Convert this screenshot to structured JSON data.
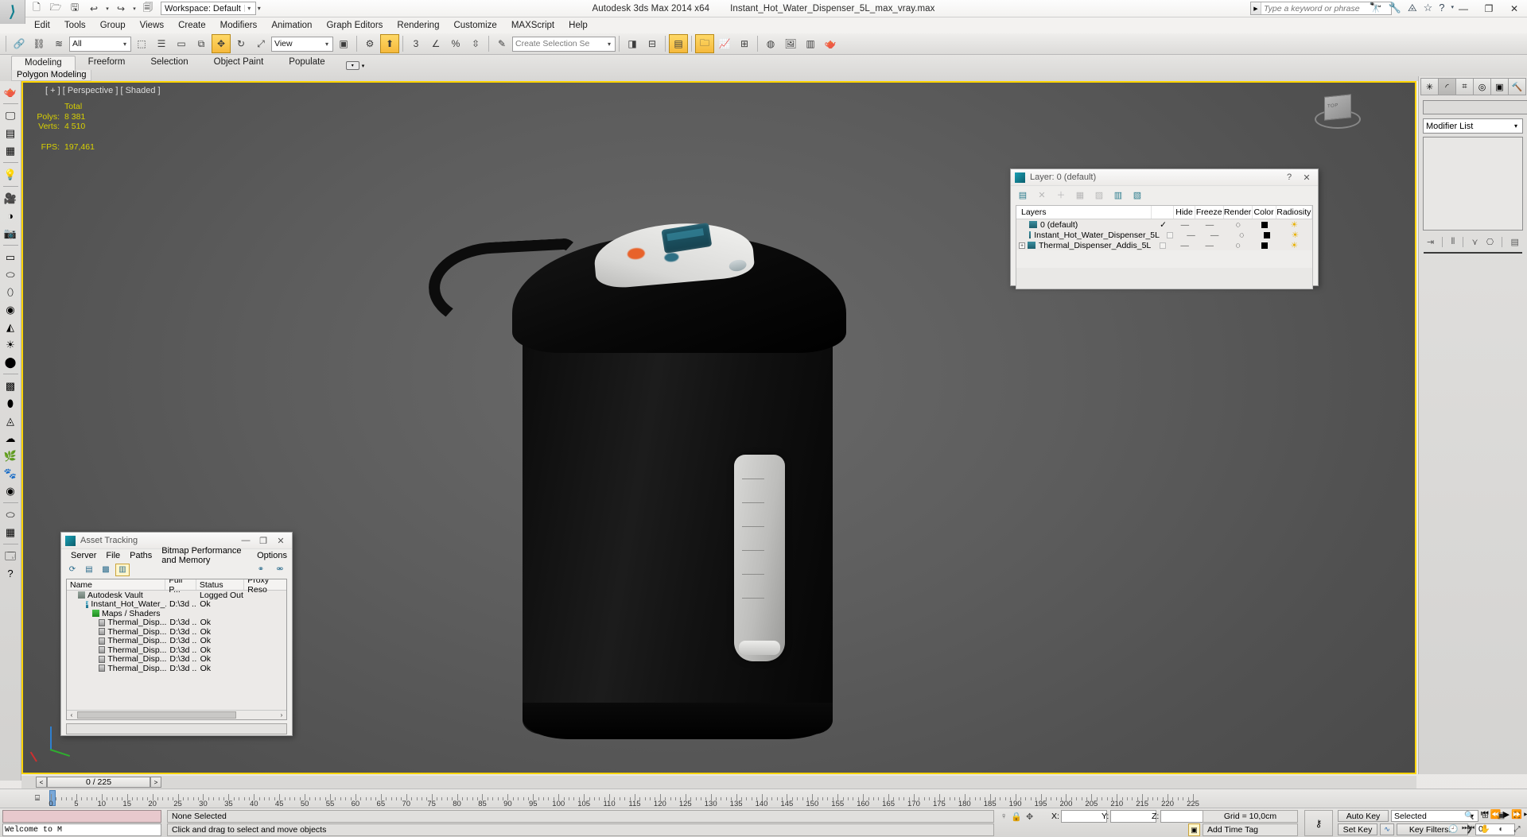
{
  "app": {
    "title": "Autodesk 3ds Max  2014 x64",
    "filename": "Instant_Hot_Water_Dispenser_5L_max_vray.max",
    "workspace_label": "Workspace: Default",
    "search_placeholder": "Type a keyword or phrase"
  },
  "menu": [
    "Edit",
    "Tools",
    "Group",
    "Views",
    "Create",
    "Modifiers",
    "Animation",
    "Graph Editors",
    "Rendering",
    "Customize",
    "MAXScript",
    "Help"
  ],
  "toolbar": {
    "selection_filter": "All",
    "reference_coord": "View",
    "named_selection_set": "Create Selection Se"
  },
  "ribbon": {
    "tabs": [
      "Modeling",
      "Freeform",
      "Selection",
      "Object Paint",
      "Populate"
    ],
    "active_tab": "Modeling",
    "panel_label": "Polygon Modeling"
  },
  "viewport": {
    "label": "[ + ] [ Perspective ] [ Shaded ]",
    "stats_header": "Total",
    "polys_label": "Polys:",
    "polys_value": "8 381",
    "verts_label": "Verts:",
    "verts_value": "4 510",
    "fps_label": "FPS:",
    "fps_value": "197,461"
  },
  "command_panel": {
    "object_name": "",
    "modifier_list": "Modifier List",
    "color_swatch": "#c7208a"
  },
  "layer_dialog": {
    "title": "Layer: 0 (default)",
    "help_label": "?",
    "close_label": "✕",
    "columns": [
      "Layers",
      "",
      "Hide",
      "Freeze",
      "Render",
      "Color",
      "Radiosity"
    ],
    "rows": [
      {
        "name": "0 (default)",
        "current": true,
        "hide": "—",
        "freeze": "—",
        "render": "on",
        "color": "#000000",
        "radiosity": "on",
        "expandable": false
      },
      {
        "name": "Instant_Hot_Water_Dispenser_5L",
        "current": false,
        "hide": "—",
        "freeze": "—",
        "render": "on",
        "color": "#000000",
        "radiosity": "on",
        "expandable": false
      },
      {
        "name": "Thermal_Dispenser_Addis_5L",
        "current": false,
        "hide": "—",
        "freeze": "—",
        "render": "on",
        "color": "#000000",
        "radiosity": "on",
        "expandable": true
      }
    ]
  },
  "asset_dialog": {
    "title": "Asset Tracking",
    "minimize_label": "—",
    "maximize_label": "❐",
    "close_label": "✕",
    "menu": [
      "Server",
      "File",
      "Paths",
      "Bitmap Performance and Memory",
      "Options"
    ],
    "columns": [
      "Name",
      "Full P...",
      "Status",
      "Proxy Reso"
    ],
    "rows": [
      {
        "indent": 1,
        "icon": "vault-icon",
        "name": "Autodesk Vault",
        "path": "",
        "status": "Logged Out ...",
        "proxy": ""
      },
      {
        "indent": 2,
        "icon": "scene-icon",
        "name": "Instant_Hot_Water_...",
        "path": "D:\\3d ...",
        "status": "Ok",
        "proxy": ""
      },
      {
        "indent": 3,
        "icon": "maps-icon",
        "name": "Maps / Shaders",
        "path": "",
        "status": "",
        "proxy": ""
      },
      {
        "indent": 4,
        "icon": "bitmap-icon",
        "name": "Thermal_Disp...",
        "path": "D:\\3d ...",
        "status": "Ok",
        "proxy": ""
      },
      {
        "indent": 4,
        "icon": "bitmap-icon",
        "name": "Thermal_Disp...",
        "path": "D:\\3d ...",
        "status": "Ok",
        "proxy": ""
      },
      {
        "indent": 4,
        "icon": "bitmap-icon",
        "name": "Thermal_Disp...",
        "path": "D:\\3d ...",
        "status": "Ok",
        "proxy": ""
      },
      {
        "indent": 4,
        "icon": "bitmap-icon",
        "name": "Thermal_Disp...",
        "path": "D:\\3d ...",
        "status": "Ok",
        "proxy": ""
      },
      {
        "indent": 4,
        "icon": "bitmap-icon",
        "name": "Thermal_Disp...",
        "path": "D:\\3d ...",
        "status": "Ok",
        "proxy": ""
      },
      {
        "indent": 4,
        "icon": "bitmap-icon",
        "name": "Thermal_Disp...",
        "path": "D:\\3d ...",
        "status": "Ok",
        "proxy": ""
      }
    ],
    "status_text": ""
  },
  "timeline": {
    "current_frame_display": "0 / 225",
    "prev_label": "<",
    "next_label": ">",
    "ruler_ticks": [
      0,
      5,
      10,
      15,
      20,
      25,
      30,
      35,
      40,
      45,
      50,
      55,
      60,
      65,
      70,
      75,
      80,
      85,
      90,
      95,
      100,
      105,
      110,
      115,
      120,
      125,
      130,
      135,
      140,
      145,
      150,
      155,
      160,
      165,
      170,
      175,
      180,
      185,
      190,
      195,
      200,
      205,
      210,
      215,
      220,
      225
    ]
  },
  "status_bar": {
    "mini_listener_text": "Welcome to M",
    "selection_status": "None Selected",
    "prompt": "Click and drag to select and move objects",
    "x_label": "X:",
    "y_label": "Y:",
    "z_label": "Z:",
    "x_value": "",
    "y_value": "",
    "z_value": "",
    "grid_info": "Grid = 10,0cm",
    "add_time_tag": "Add Time Tag",
    "auto_key": "Auto Key",
    "set_key": "Set Key",
    "key_mode_selection": "Selected",
    "key_filters": "Key Filters...",
    "frame_field": "0"
  }
}
